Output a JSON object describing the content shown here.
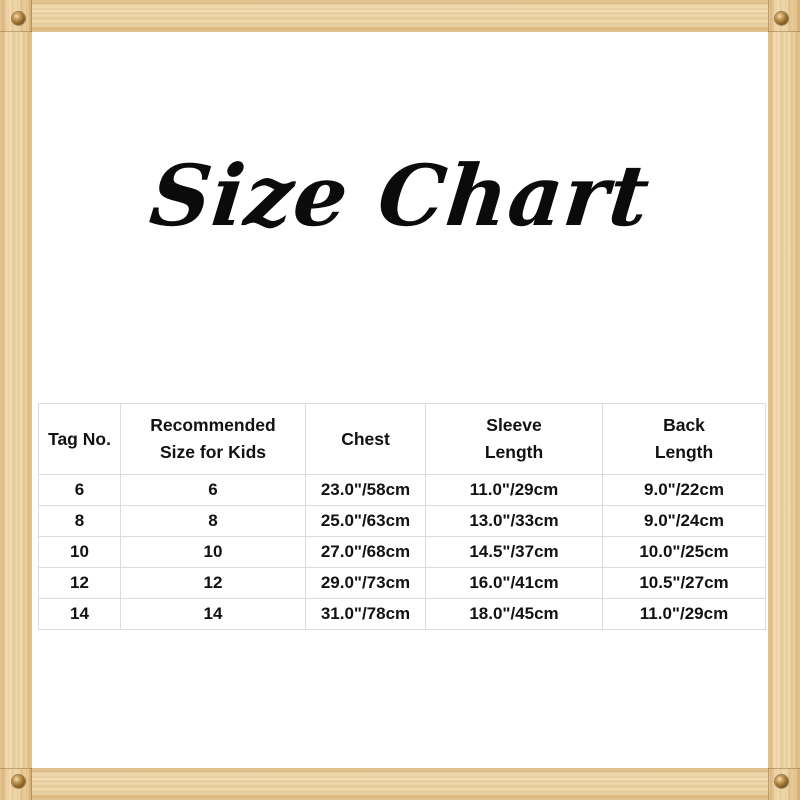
{
  "frame": {
    "material": "wood",
    "wood_color": "#e8c48e",
    "screw_color": "#8d6227",
    "screws": [
      {
        "name": "screw-top-left"
      },
      {
        "name": "screw-top-right"
      },
      {
        "name": "screw-bottom-left"
      },
      {
        "name": "screw-bottom-right"
      }
    ]
  },
  "panel": {
    "background": "#ffffff"
  },
  "title": {
    "text": "Size Chart",
    "color": "#0b0b0b"
  },
  "chart_data": {
    "type": "table",
    "title": "Size Chart",
    "columns": [
      {
        "line1": "Tag No.",
        "line2": ""
      },
      {
        "line1": "Recommended",
        "line2": "Size for Kids"
      },
      {
        "line1": "Chest",
        "line2": ""
      },
      {
        "line1": "Sleeve",
        "line2": "Length"
      },
      {
        "line1": "Back",
        "line2": "Length"
      }
    ],
    "headers": [
      "Tag No.",
      "Recommended Size for Kids",
      "Chest",
      "Sleeve Length",
      "Back Length"
    ],
    "rows": [
      {
        "tag_no": "6",
        "recommended_size": "6",
        "chest": "23.0\"/58cm",
        "sleeve_length": "11.0\"/29cm",
        "back_length": "9.0\"/22cm"
      },
      {
        "tag_no": "8",
        "recommended_size": "8",
        "chest": "25.0\"/63cm",
        "sleeve_length": "13.0\"/33cm",
        "back_length": "9.0\"/24cm"
      },
      {
        "tag_no": "10",
        "recommended_size": "10",
        "chest": "27.0\"/68cm",
        "sleeve_length": "14.5\"/37cm",
        "back_length": "10.0\"/25cm"
      },
      {
        "tag_no": "12",
        "recommended_size": "12",
        "chest": "29.0\"/73cm",
        "sleeve_length": "16.0\"/41cm",
        "back_length": "10.5\"/27cm"
      },
      {
        "tag_no": "14",
        "recommended_size": "14",
        "chest": "31.0\"/78cm",
        "sleeve_length": "18.0\"/45cm",
        "back_length": "11.0\"/29cm"
      }
    ],
    "border_color": "#dcdcdc",
    "text_color": "#121212"
  }
}
